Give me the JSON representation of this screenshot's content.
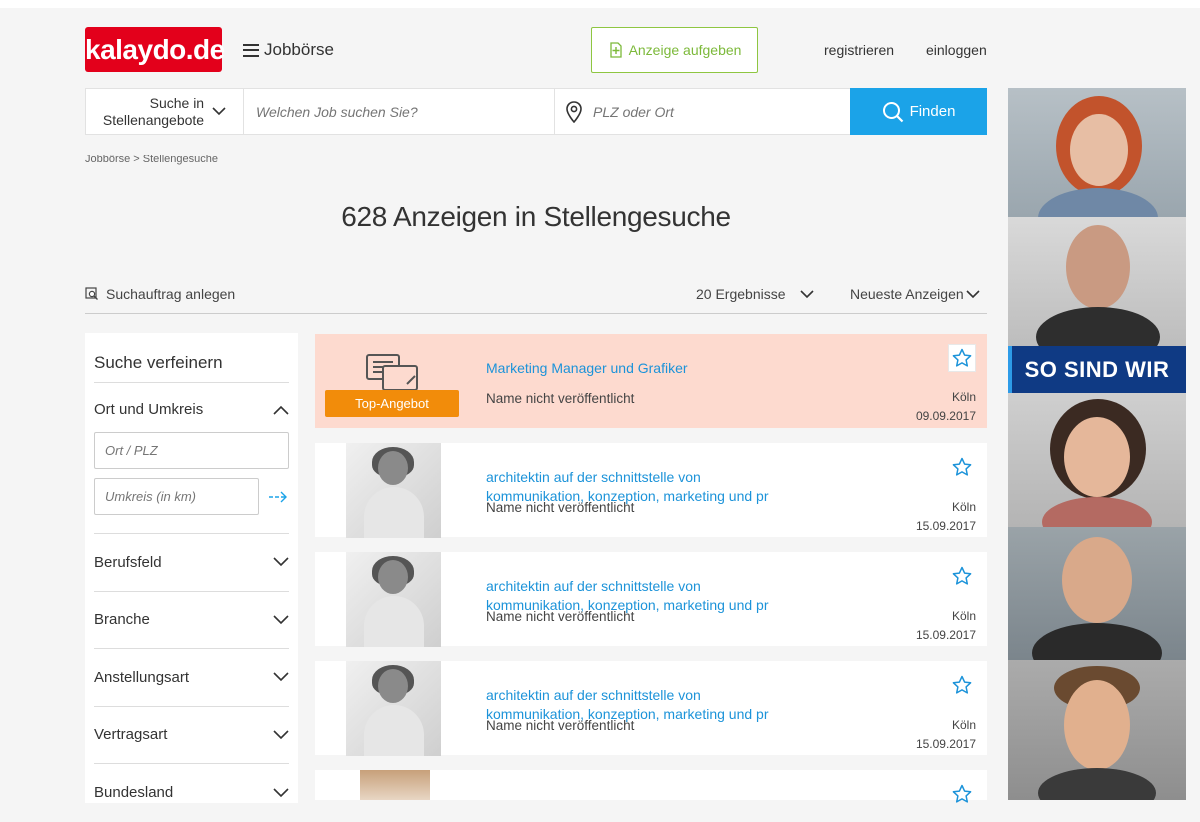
{
  "header": {
    "logo": "kalaydo.de",
    "menu_label": "Jobbörse",
    "post_ad_label": "Anzeige aufgeben",
    "register": "registrieren",
    "login": "einloggen"
  },
  "search": {
    "scope_line1": "Suche in",
    "scope_line2": "Stellenangebote",
    "job_placeholder": "Welchen Job suchen Sie?",
    "location_placeholder": "PLZ oder Ort",
    "submit_label": "Finden"
  },
  "breadcrumb": "Jobbörse  >  Stellengesuche",
  "page_title": "628 Anzeigen in Stellengesuche",
  "toolbar": {
    "alert_label": "Suchauftrag anlegen",
    "per_page": "20 Ergebnisse",
    "sort": "Neueste Anzeigen"
  },
  "sidebar": {
    "title": "Suche verfeinern",
    "location_section": "Ort und Umkreis",
    "location_placeholder": "Ort / PLZ",
    "radius_placeholder": "Umkreis (in km)",
    "sections": [
      "Berufsfeld",
      "Branche",
      "Anstellungsart",
      "Vertragsart",
      "Bundesland"
    ]
  },
  "listings": [
    {
      "badge": "Top-Angebot",
      "title_line1": "Marketing Manager und Grafiker",
      "title_line2": "",
      "name": "Name nicht veröffentlicht",
      "city": "Köln",
      "date": "09.09.2017"
    },
    {
      "title_line1": "architektin auf der schnittstelle von",
      "title_line2": "kommunikation, konzeption, marketing und pr",
      "name": "Name nicht veröffentlicht",
      "city": "Köln",
      "date": "15.09.2017"
    },
    {
      "title_line1": "architektin auf der schnittstelle von",
      "title_line2": "kommunikation, konzeption, marketing und pr",
      "name": "Name nicht veröffentlicht",
      "city": "Köln",
      "date": "15.09.2017"
    },
    {
      "title_line1": "architektin auf der schnittstelle von",
      "title_line2": "kommunikation, konzeption, marketing und pr",
      "name": "Name nicht veröffentlicht",
      "city": "Köln",
      "date": "15.09.2017"
    }
  ],
  "side_ad": {
    "banner": "SO SIND WIR"
  },
  "colors": {
    "brand_red": "#e3001b",
    "accent_blue": "#1ba3e8",
    "link_blue": "#1c93d9",
    "post_green": "#7cb93a",
    "top_highlight": "#fddacf",
    "badge_orange": "#f28c0a",
    "ad_blue": "#0f3a84"
  }
}
